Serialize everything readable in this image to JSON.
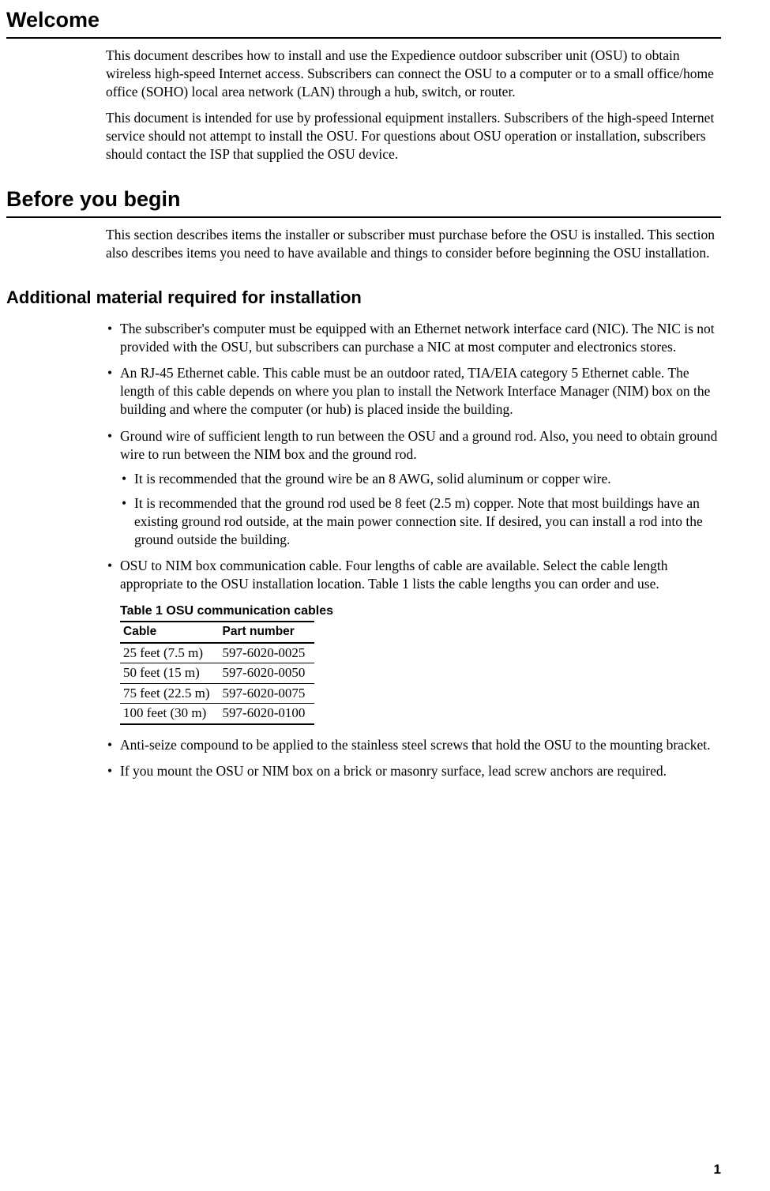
{
  "page_number": "1",
  "headings": {
    "welcome": "Welcome",
    "before_you_begin": "Before you begin",
    "additional_material": "Additional material required for installation"
  },
  "welcome_p1": "This document describes how to install and use the Expedience outdoor subscriber unit (OSU) to obtain wireless high-speed Internet access. Subscribers can connect the OSU to a computer or to a small office/home office (SOHO) local area network (LAN) through a hub, switch, or router.",
  "welcome_p2": "This document is intended for use by professional equipment installers. Subscribers of the high-speed Internet service should not attempt to install the OSU. For questions about OSU operation or installation, subscribers should contact the ISP that supplied the OSU device.",
  "before_p1": "This section describes items the installer or subscriber must purchase before the OSU is installed. This section also describes items you need to have available and things to consider before beginning the OSU installation.",
  "bullets": {
    "b1": "The subscriber's computer must be equipped with an Ethernet network interface card (NIC). The NIC is not provided with the OSU, but subscribers can purchase a NIC at most computer and electronics stores.",
    "b2": "An RJ-45 Ethernet cable. This cable must be an outdoor rated, TIA/EIA category 5 Ethernet cable. The length of this cable depends on where you plan to install the Network Interface Manager (NIM) box on the building and where the computer (or hub) is placed inside the building.",
    "b3": "Ground wire of sufficient length to run between the OSU and a ground rod. Also, you need to obtain ground wire to run between the NIM box and the ground rod.",
    "b3a": "It is recommended that the ground wire be an 8 AWG, solid aluminum or copper wire.",
    "b3b": "It is recommended that the ground rod used be 8 feet (2.5 m) copper. Note that most buildings have an existing ground rod outside, at the main power connection site. If desired, you can install a rod into the ground outside the building.",
    "b4": "OSU to NIM box communication cable. Four lengths of cable are available. Select the cable length appropriate to the OSU installation location. Table 1 lists the cable lengths you can order and use.",
    "b5": "Anti-seize compound to be applied to the stainless steel screws that hold the OSU to the mounting bracket.",
    "b6": "If you mount the OSU or NIM box on a brick or masonry surface, lead screw anchors are required."
  },
  "table": {
    "title": "Table 1  OSU communication cables",
    "headers": {
      "col1": "Cable",
      "col2": "Part number"
    },
    "rows": [
      {
        "cable": "25 feet (7.5 m)",
        "part": "597-6020-0025"
      },
      {
        "cable": "50 feet (15 m)",
        "part": "597-6020-0050"
      },
      {
        "cable": "75 feet (22.5 m)",
        "part": "597-6020-0075"
      },
      {
        "cable": "100 feet (30 m)",
        "part": "597-6020-0100"
      }
    ]
  }
}
